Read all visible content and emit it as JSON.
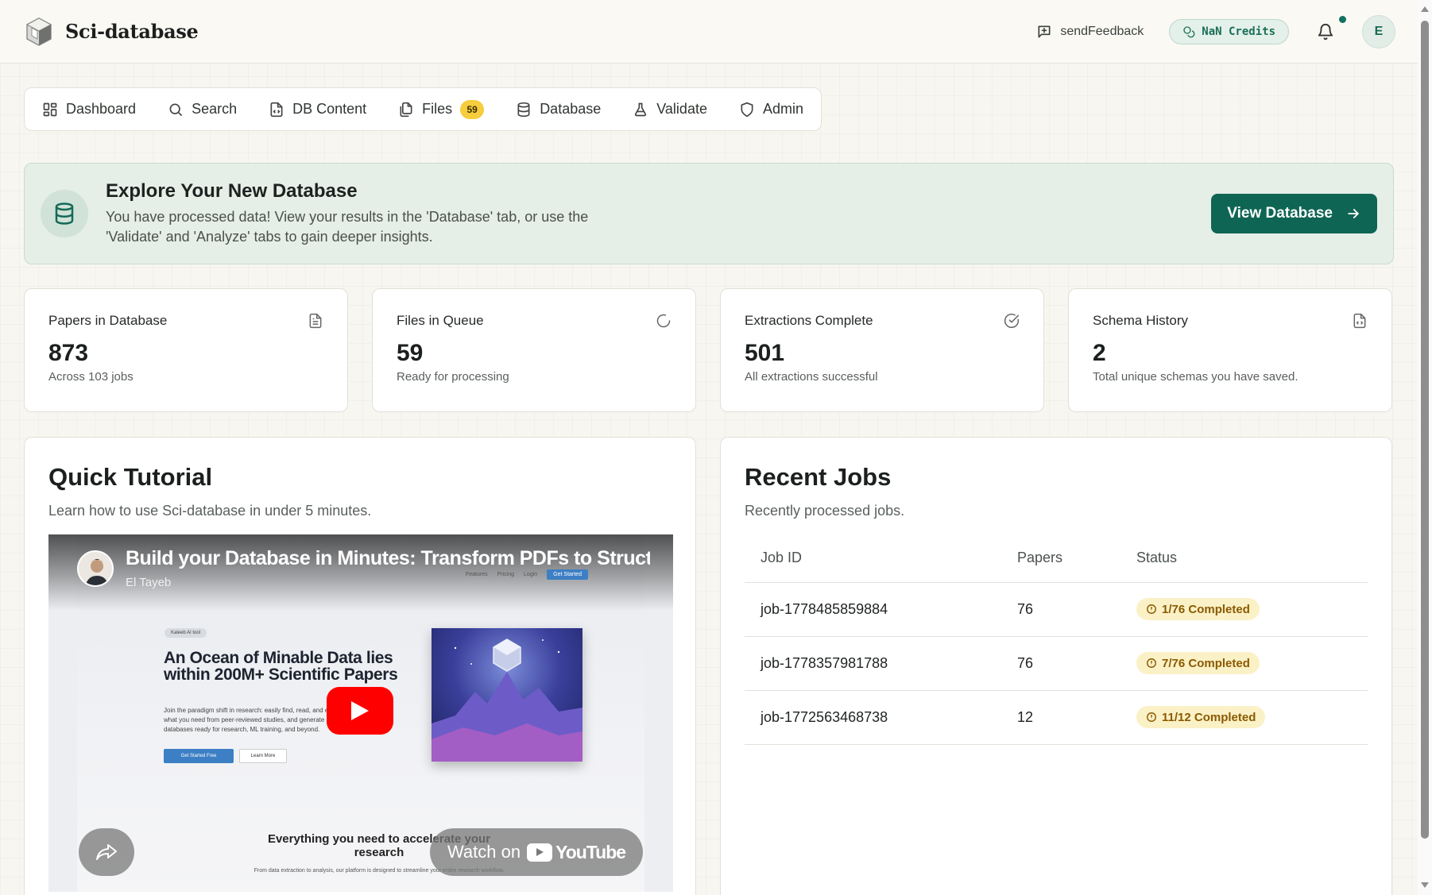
{
  "app": {
    "name": "Sci-database",
    "feedback_label": "sendFeedback",
    "credits_label": "NaN Credits",
    "avatar_initial": "E",
    "accent": "#0f6553"
  },
  "nav": {
    "items": [
      {
        "label": "Dashboard",
        "icon": "dashboard-icon"
      },
      {
        "label": "Search",
        "icon": "search-icon"
      },
      {
        "label": "DB Content",
        "icon": "file-code-icon"
      },
      {
        "label": "Files",
        "icon": "files-icon",
        "badge": "59"
      },
      {
        "label": "Database",
        "icon": "database-icon"
      },
      {
        "label": "Validate",
        "icon": "flask-icon"
      },
      {
        "label": "Admin",
        "icon": "shield-icon"
      }
    ]
  },
  "banner": {
    "title": "Explore Your New Database",
    "description": "You have processed data! View your results in the 'Database' tab, or use the 'Validate' and 'Analyze' tabs to gain deeper insights.",
    "button_label": "View Database"
  },
  "stats": [
    {
      "label": "Papers in Database",
      "value": "873",
      "sub": "Across 103 jobs",
      "icon": "document-icon"
    },
    {
      "label": "Files in Queue",
      "value": "59",
      "sub": "Ready for processing",
      "icon": "loader-icon"
    },
    {
      "label": "Extractions Complete",
      "value": "501",
      "sub": "All extractions successful",
      "icon": "check-circle-icon"
    },
    {
      "label": "Schema History",
      "value": "2",
      "sub": "Total unique schemas you have saved.",
      "icon": "file-code-icon"
    }
  ],
  "tutorial": {
    "title": "Quick Tutorial",
    "subtitle": "Learn how to use Sci-database in under 5 minutes.",
    "video": {
      "title": "Build your Database in Minutes: Transform PDFs to Struct",
      "channel": "El Tayeb",
      "watch_label": "Watch on",
      "yt_label": "YouTube",
      "site_nav": [
        "Features",
        "Pricing",
        "Login"
      ],
      "site_cta": "Get Started",
      "hero_chip": "Kaleeb AI tool",
      "hero_heading": "An Ocean of Minable Data lies within 200M+ Scientific Papers",
      "hero_body": "Join the paradigm shift in research: easily find, read, and extract exactly what you need from peer-reviewed studies, and generate structured databases ready for research, ML training, and beyond.",
      "hero_btn_primary": "Get Started Free",
      "hero_btn_secondary": "Learn More",
      "section_heading": "Everything you need to accelerate your research",
      "section_body": "From data extraction to analysis, our platform is designed to streamline your entire research workflow."
    }
  },
  "jobs": {
    "title": "Recent Jobs",
    "subtitle": "Recently processed jobs.",
    "columns": [
      "Job ID",
      "Papers",
      "Status"
    ],
    "rows": [
      {
        "id": "job-1778485859884",
        "papers": "76",
        "status": "1/76 Completed"
      },
      {
        "id": "job-1778357981788",
        "papers": "76",
        "status": "7/76 Completed"
      },
      {
        "id": "job-1772563468738",
        "papers": "12",
        "status": "11/12 Completed"
      }
    ]
  }
}
